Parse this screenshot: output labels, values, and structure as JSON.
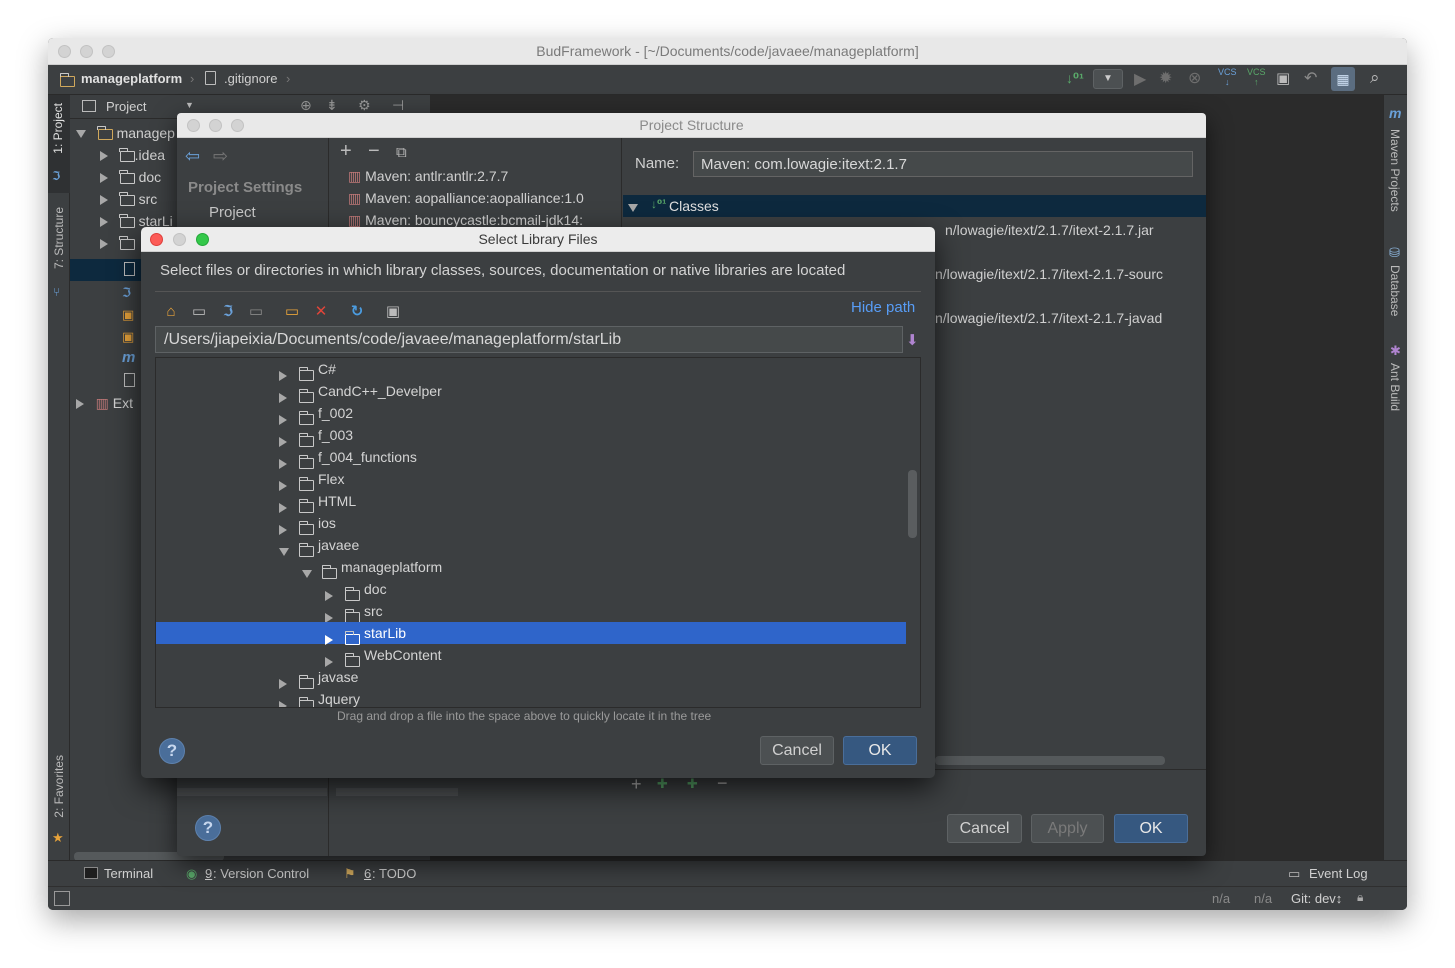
{
  "window": {
    "title": "BudFramework - [~/Documents/code/javaee/manageplatform]"
  },
  "breadcrumb": {
    "project": "manageplatform",
    "file": ".gitignore"
  },
  "left_toolwindows": {
    "project": "1: Project",
    "structure": "7: Structure",
    "favorites": "2: Favorites"
  },
  "right_toolwindows": {
    "maven": "Maven Projects",
    "database": "Database",
    "ant": "Ant Build"
  },
  "project_panel": {
    "header": "Project",
    "root": "managep",
    "items": [
      ".idea",
      "doc",
      "src",
      "starLi"
    ],
    "external": "Ext"
  },
  "bottom_tabs": {
    "terminal": "Terminal",
    "vcs_num": "9",
    "vcs_label": ": Version Control",
    "todo_num": "6",
    "todo_label": ": TODO",
    "event_log": "Event Log"
  },
  "status": {
    "na1": "n/a",
    "na2": "n/a",
    "git": "Git: dev↕"
  },
  "project_structure": {
    "title": "Project Structure",
    "settings_heading": "Project Settings",
    "settings_item": "Project",
    "libraries": [
      "Maven: antlr:antlr:2.7.7",
      "Maven: aopalliance:aopalliance:1.0",
      "Maven: bouncycastle:bcmail-jdk14:"
    ],
    "name_label": "Name:",
    "name_value": "Maven: com.lowagie:itext:2.1.7",
    "classes_label": "Classes",
    "paths": [
      "n/lowagie/itext/2.1.7/itext-2.1.7.jar",
      "n/lowagie/itext/2.1.7/itext-2.1.7-sourc",
      "n/lowagie/itext/2.1.7/itext-2.1.7-javad"
    ],
    "cancel": "Cancel",
    "apply": "Apply",
    "ok": "OK",
    "help": "?"
  },
  "select_library": {
    "title": "Select Library Files",
    "description": "Select files or directories in which library classes, sources, documentation or native libraries are located",
    "hide_path": "Hide path",
    "path": "/Users/jiapeixia/Documents/code/javaee/manageplatform/starLib",
    "tree": [
      {
        "label": "C#",
        "depth": 0,
        "expanded": false,
        "selected": false
      },
      {
        "label": "CandC++_Develper",
        "depth": 0,
        "expanded": false,
        "selected": false
      },
      {
        "label": "f_002",
        "depth": 0,
        "expanded": false,
        "selected": false
      },
      {
        "label": "f_003",
        "depth": 0,
        "expanded": false,
        "selected": false
      },
      {
        "label": "f_004_functions",
        "depth": 0,
        "expanded": false,
        "selected": false
      },
      {
        "label": "Flex",
        "depth": 0,
        "expanded": false,
        "selected": false
      },
      {
        "label": "HTML",
        "depth": 0,
        "expanded": false,
        "selected": false
      },
      {
        "label": "ios",
        "depth": 0,
        "expanded": false,
        "selected": false
      },
      {
        "label": "javaee",
        "depth": 0,
        "expanded": true,
        "selected": false
      },
      {
        "label": "manageplatform",
        "depth": 1,
        "expanded": true,
        "selected": false
      },
      {
        "label": "doc",
        "depth": 2,
        "expanded": false,
        "selected": false
      },
      {
        "label": "src",
        "depth": 2,
        "expanded": false,
        "selected": false
      },
      {
        "label": "starLib",
        "depth": 2,
        "expanded": false,
        "selected": true
      },
      {
        "label": "WebContent",
        "depth": 2,
        "expanded": false,
        "selected": false
      },
      {
        "label": "javase",
        "depth": 0,
        "expanded": false,
        "selected": false
      },
      {
        "label": "Jquery",
        "depth": 0,
        "expanded": false,
        "selected": false
      }
    ],
    "hint": "Drag and drop a file into the space above to quickly locate it in the tree",
    "cancel": "Cancel",
    "ok": "OK",
    "help": "?"
  },
  "colors": {
    "selection": "#2f65ca",
    "ok_button": "#365880",
    "link": "#589df6",
    "close_red": "#fc5b57",
    "zoom_green": "#34c84a"
  }
}
